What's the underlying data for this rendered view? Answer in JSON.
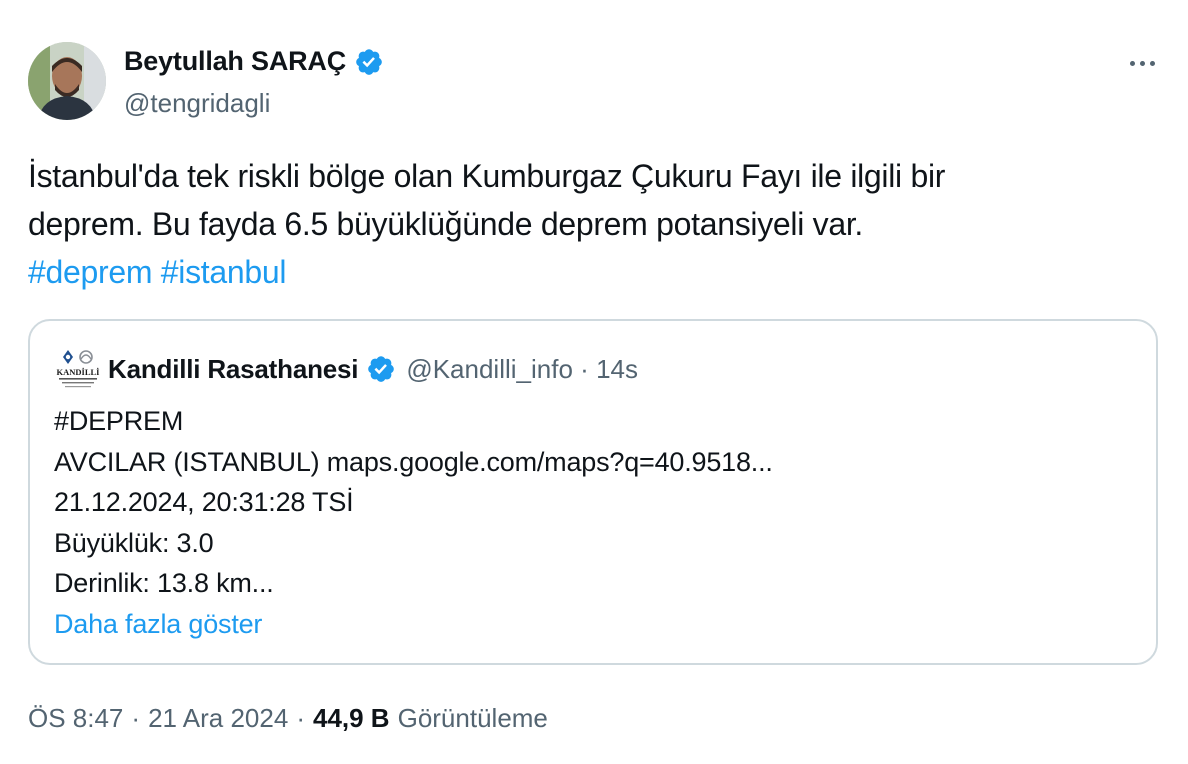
{
  "author": {
    "name": "Beytullah SARAÇ",
    "handle": "@tengridagli",
    "verified": true
  },
  "tweet": {
    "lines": [
      "İstanbul'da tek riskli bölge olan Kumburgaz Çukuru Fayı ile ilgili bir",
      "deprem. Bu fayda 6.5 büyüklüğünde deprem potansiyeli var."
    ],
    "hashtags": [
      "#deprem",
      "#istanbul"
    ]
  },
  "quoted": {
    "name": "Kandilli Rasathanesi",
    "handle": "@Kandilli_info",
    "time": "14s",
    "meta_separator": "·",
    "logo_text": "KANDİLLİ",
    "lines": [
      "#DEPREM",
      "AVCILAR (ISTANBUL) maps.google.com/maps?q=40.9518...",
      "21.12.2024, 20:31:28 TSİ",
      "Büyüklük: 3.0",
      "Derinlik: 13.8 km..."
    ],
    "show_more": "Daha fazla göster"
  },
  "footer": {
    "time": "ÖS 8:47",
    "date": "21 Ara 2024",
    "separator": "·",
    "views_count": "44,9 B",
    "views_label": "Görüntüleme"
  },
  "colors": {
    "link": "#1d9bf0",
    "secondary_text": "#536471",
    "border": "#cfd9de",
    "verified_badge": "#1d9bf0"
  },
  "icons": [
    "verified-badge-icon",
    "more-options-icon"
  ]
}
